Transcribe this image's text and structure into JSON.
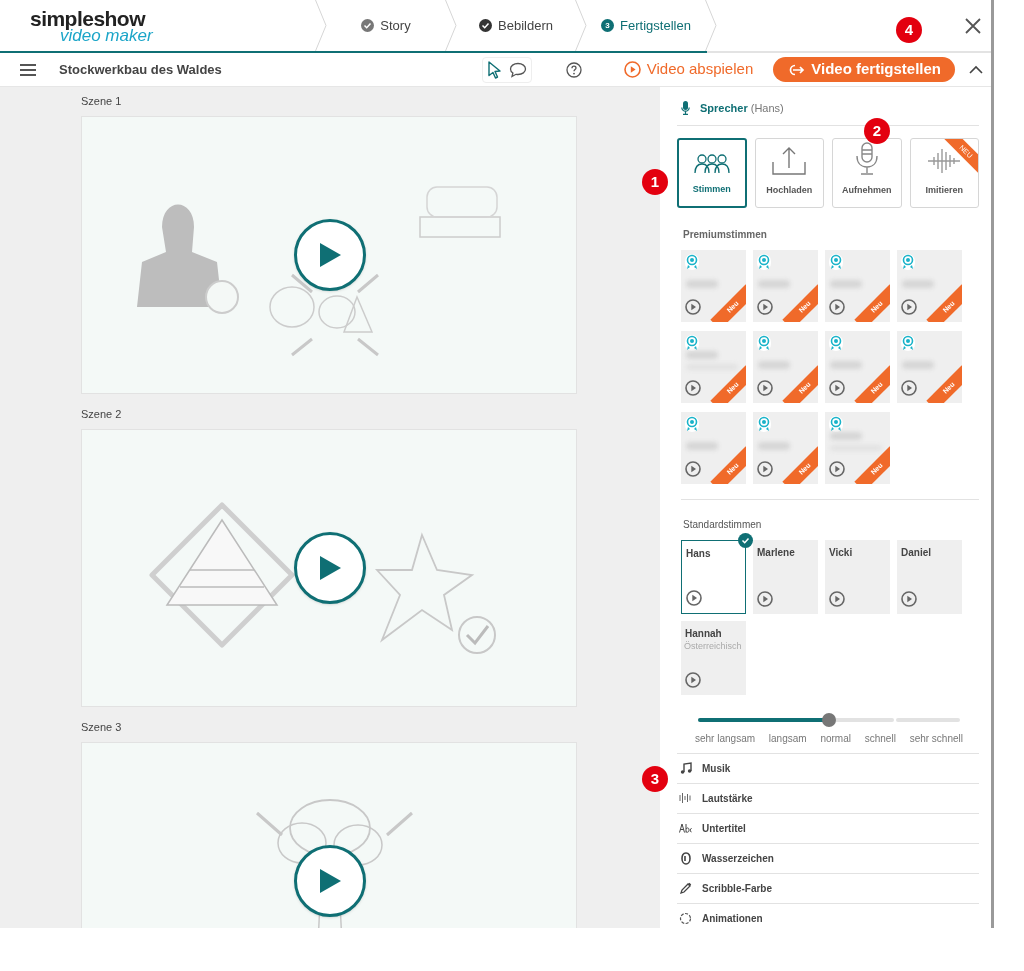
{
  "logo": {
    "line1": "simpleshow",
    "line2": "video maker"
  },
  "steps": [
    {
      "label": "Story",
      "kind": "done",
      "selected": false
    },
    {
      "label": "Bebildern",
      "kind": "done",
      "selected": false
    },
    {
      "label": "Fertigstellen",
      "kind": "current",
      "number": "3",
      "selected": true
    }
  ],
  "toolbar": {
    "title": "Stockwerkbau des Waldes",
    "play_link": "Video abspielen",
    "finish_button": "Video fertigstellen"
  },
  "scenes": [
    {
      "label": "Szene 1"
    },
    {
      "label": "Szene 2"
    },
    {
      "label": "Szene 3"
    }
  ],
  "panel": {
    "speaker_label": "Sprecher",
    "speaker_name": "(Hans)",
    "sources": [
      {
        "label": "Stimmen",
        "kind": "people",
        "selected": true
      },
      {
        "label": "Hochladen",
        "kind": "upload",
        "selected": false
      },
      {
        "label": "Aufnehmen",
        "kind": "mic",
        "selected": false
      },
      {
        "label": "Imitieren",
        "kind": "wave",
        "selected": false,
        "ribbon": "NEU"
      }
    ],
    "premium_heading": "Premiumstimmen",
    "premium_voices": [
      {
        "ribbon": "Neu"
      },
      {
        "ribbon": "Neu"
      },
      {
        "ribbon": "Neu"
      },
      {
        "ribbon": "Neu"
      },
      {
        "ribbon": "Neu",
        "subtitle": true
      },
      {
        "ribbon": "Neu"
      },
      {
        "ribbon": "Neu"
      },
      {
        "ribbon": "Neu"
      },
      {
        "ribbon": "Neu"
      },
      {
        "ribbon": "Neu"
      },
      {
        "ribbon": "Neu",
        "subtitle": true
      }
    ],
    "standard_heading": "Standardstimmen",
    "standard_voices": [
      {
        "name": "Hans",
        "selected": true
      },
      {
        "name": "Marlene",
        "selected": false
      },
      {
        "name": "Vicki",
        "selected": false
      },
      {
        "name": "Daniel",
        "selected": false
      },
      {
        "name": "Hannah",
        "note": "Österreichisch",
        "selected": false
      }
    ],
    "speed": {
      "level": 0.5,
      "labels": [
        "sehr langsam",
        "langsam",
        "normal",
        "schnell",
        "sehr schnell"
      ]
    },
    "sections": [
      {
        "label": "Musik",
        "kind": "music"
      },
      {
        "label": "Lautstärke",
        "kind": "volume"
      },
      {
        "label": "Untertitel",
        "kind": "subtitle"
      },
      {
        "label": "Wasserzeichen",
        "kind": "watermark"
      },
      {
        "label": "Scribble-Farbe",
        "kind": "pen"
      },
      {
        "label": "Animationen",
        "kind": "animation"
      }
    ]
  },
  "callouts": [
    {
      "label": "1"
    },
    {
      "label": "2"
    },
    {
      "label": "3"
    },
    {
      "label": "4"
    }
  ]
}
